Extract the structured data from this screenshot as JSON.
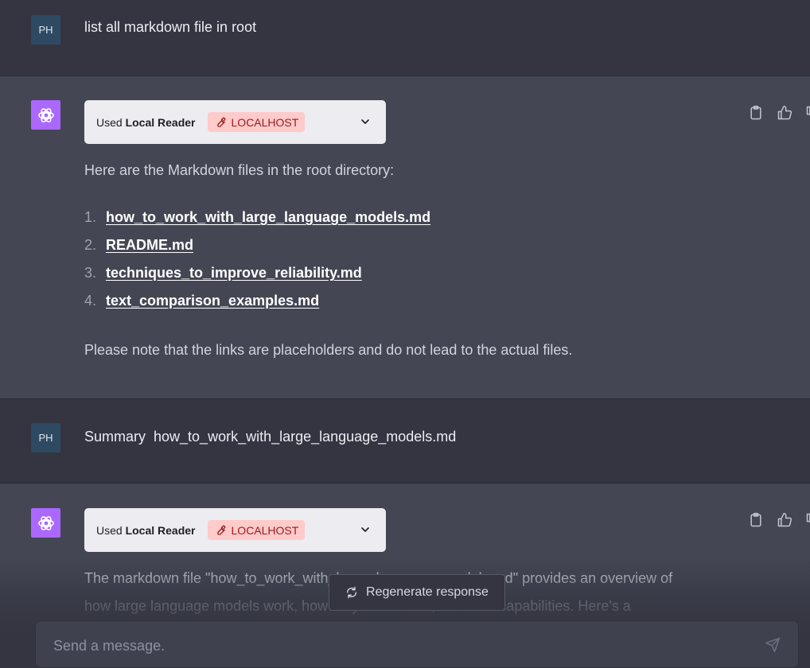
{
  "messages": [
    {
      "avatar": "PH",
      "text": "list all markdown file in root"
    },
    {
      "plugin": {
        "used_prefix": "Used",
        "plugin_name": "Local Reader",
        "badge": "LOCALHOST"
      },
      "intro": "Here are the Markdown files in the root directory:",
      "files": [
        {
          "num": "1.",
          "name": "how_to_work_with_large_language_models.md"
        },
        {
          "num": "2.",
          "name": "README.md"
        },
        {
          "num": "3.",
          "name": "techniques_to_improve_reliability.md"
        },
        {
          "num": "4.",
          "name": "text_comparison_examples.md"
        }
      ],
      "note": "Please note that the links are placeholders and do not lead to the actual files."
    },
    {
      "avatar": "PH",
      "text": "Summary  how_to_work_with_large_language_models.md"
    },
    {
      "plugin": {
        "used_prefix": "Used",
        "plugin_name": "Local Reader",
        "badge": "LOCALHOST"
      },
      "line1": "The markdown file \"how_to_work_with_large_language_models.md\" provides an overview of",
      "line2": "how large language models work, how they are trained, and their capabilities. Here's a"
    }
  ],
  "regenerate_label": "Regenerate response",
  "composer": {
    "placeholder": "Send a message."
  },
  "icons": {
    "bot_avatar": "openai-logo-icon",
    "copy": "clipboard-icon",
    "like": "thumbs-up-icon",
    "dislike": "thumbs-down-icon",
    "tool": "wrench-icon",
    "chevron": "chevron-down-icon",
    "regenerate": "refresh-icon",
    "send": "paper-plane-icon"
  },
  "colors": {
    "background": "#343541",
    "bot_row": "#444654",
    "bot_avatar": "#ab68ff",
    "user_avatar": "#2e4a63",
    "badge_bg": "#fecaca",
    "badge_text": "#991b1b"
  }
}
